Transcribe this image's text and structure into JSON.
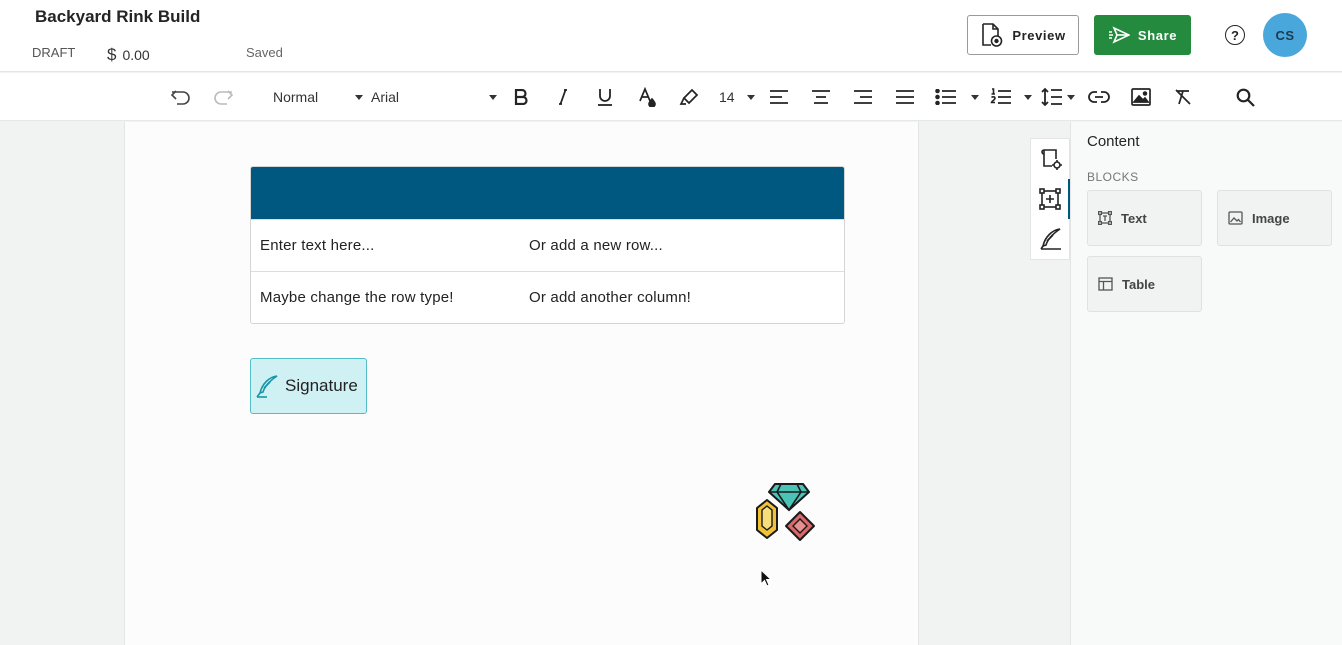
{
  "header": {
    "title": "Backyard Rink Build",
    "status": "DRAFT",
    "currency_symbol": "$",
    "price": "0.00",
    "save_state": "Saved",
    "preview_label": "Preview",
    "share_label": "Share",
    "help_label": "?",
    "avatar_initials": "CS",
    "share_color": "#248a3d",
    "avatar_color": "#4aa7dc"
  },
  "toolbar": {
    "style_value": "Normal",
    "font_value": "Arial",
    "size_value": "14",
    "icons": [
      "undo-icon",
      "redo-icon",
      "bold-icon",
      "italic-icon",
      "underline-icon",
      "text-color-icon",
      "highlight-icon",
      "align-left-icon",
      "align-center-icon",
      "align-right-icon",
      "justify-icon",
      "bullet-list-icon",
      "numbered-list-icon",
      "line-spacing-icon",
      "link-icon",
      "image-icon",
      "clear-format-icon",
      "search-icon"
    ]
  },
  "document": {
    "table_header_color": "#005880",
    "rows": [
      [
        "Enter text here...",
        "Or add a new row..."
      ],
      [
        "Maybe change the row type!",
        "Or add another column!"
      ]
    ],
    "signature_label": "Signature"
  },
  "panel": {
    "title": "Content",
    "section": "BLOCKS",
    "blocks": [
      "Text",
      "Image",
      "Table"
    ]
  }
}
